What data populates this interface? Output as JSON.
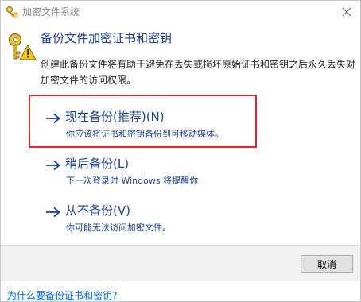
{
  "window": {
    "title": "加密文件系统",
    "close_icon": "close-icon",
    "title_icon": "efs-key-icon"
  },
  "header": {
    "icon": "key-warning-icon",
    "title": "备份文件加密证书和密钥",
    "description": "创建此备份文件将有助于避免在丢失或损坏原始证书和密钥之后永久丢失对加密文件的访问权限。"
  },
  "options": [
    {
      "icon": "arrow-right-icon",
      "title": "现在备份(推荐)(N)",
      "subtitle": "你应该将证书和密钥备份到可移动媒体。",
      "highlighted": true
    },
    {
      "icon": "arrow-right-icon",
      "title": "稍后备份(L)",
      "subtitle": "下一次登录时 Windows 将提醒你"
    },
    {
      "icon": "arrow-right-icon",
      "title": "从不备份(V)",
      "subtitle": "你可能无法访问加密文件。"
    }
  ],
  "footer": {
    "cancel_label": "取消"
  },
  "help_link": "为什么要备份证书和密钥?",
  "colors": {
    "link_blue": "#1a3e96",
    "highlight_red": "#d9292d",
    "footer_bg": "#f0f0f0",
    "help_link": "#0066cc"
  }
}
